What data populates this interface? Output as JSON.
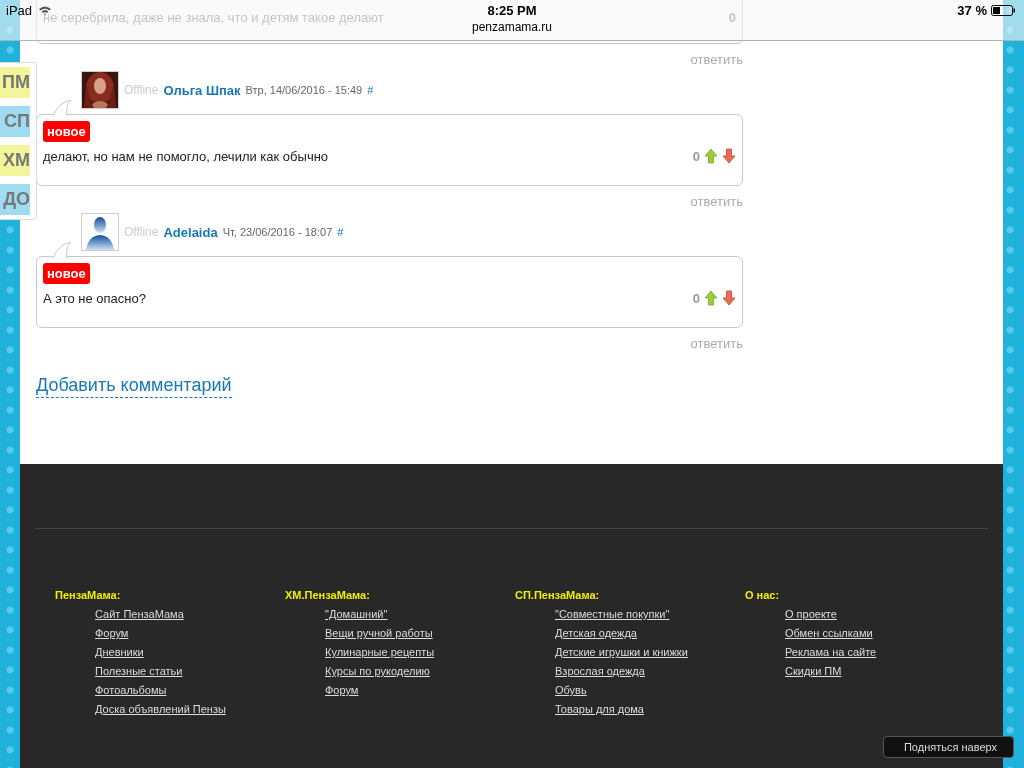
{
  "status_bar": {
    "device": "iPad",
    "time": "8:25 PM",
    "url": "penzamama.ru",
    "battery": "37 %"
  },
  "side_tabs": [
    {
      "label": "ПМ",
      "color": "#f2f59a"
    },
    {
      "label": "СП",
      "color": "#9fdcf2"
    },
    {
      "label": "ХМ",
      "color": "#f2f59a"
    },
    {
      "label": "ДО",
      "color": "#9fdcf2"
    }
  ],
  "comments": [
    {
      "kind": "partial",
      "text": "не серебрила, даже не знала, что и детям такое делают",
      "votes": "0",
      "reply": "ответить"
    },
    {
      "kind": "full",
      "status": "Offline",
      "author": "Ольга Шпак",
      "date": "Втр, 14/06/2016 - 15:49",
      "permalink": "#",
      "badge": "новое",
      "text": "делают, но нам не помогло, лечили как обычно",
      "votes": "0",
      "reply": "ответить"
    },
    {
      "kind": "full",
      "avatar": {
        "kind": "silhouette"
      },
      "status": "Offline",
      "author": "Adelaida",
      "date": "Чт, 23/06/2016 - 18:07",
      "permalink": "#",
      "badge": "новое",
      "text": "А это не опасно?",
      "votes": "0",
      "reply": "ответить"
    }
  ],
  "add_comment": "Добавить комментарий",
  "footer": {
    "columns": [
      {
        "title": "ПензаМама:",
        "links": [
          "Сайт ПензаМама",
          "Форум",
          "Дневники",
          "Полезные статьи",
          "Фотоальбомы",
          "Доска объявлений Пензы"
        ]
      },
      {
        "title": "ХМ.ПензаМама:",
        "links": [
          "\"Домашний\"",
          "Вещи ручной работы",
          "Кулинарные рецепты",
          "Курсы по рукоделию",
          "Форум"
        ]
      },
      {
        "title": "СП.ПензаМама:",
        "links": [
          "\"Совместные покупки\"",
          "Детская одежда",
          "Детские игрушки и книжки",
          "Взрослая одежда",
          "Обувь",
          "Товары для дома"
        ]
      },
      {
        "title": "О нас:",
        "links": [
          "О проекте",
          "Обмен ссылками",
          "Реклама на сайте",
          "Скидки ПМ"
        ]
      }
    ]
  },
  "back_to_top": "Подняться наверх"
}
